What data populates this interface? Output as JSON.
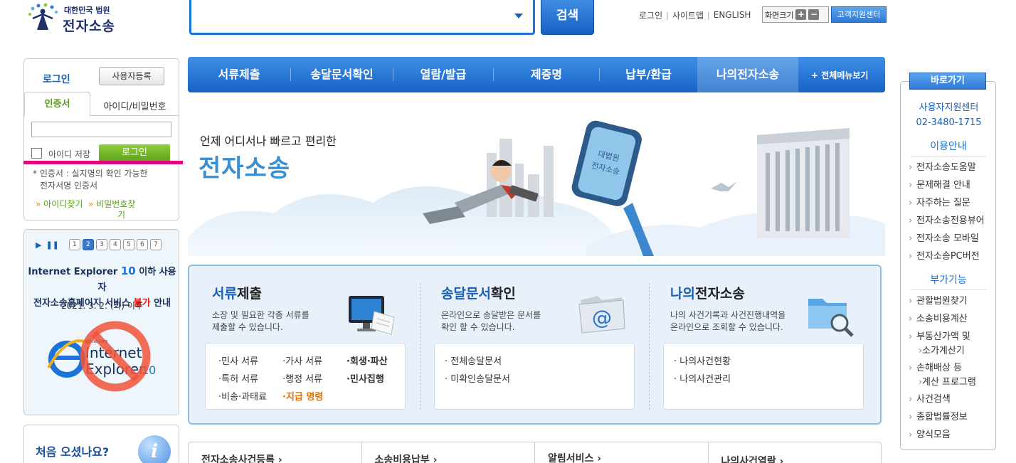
{
  "logo": {
    "small": "대한민국 법원",
    "big": "전자소송"
  },
  "search": {
    "value": "",
    "placeholder": "",
    "button_label": "검색"
  },
  "top_links": {
    "login": "로그인",
    "sitemap": "사이트맵",
    "english": "ENGLISH",
    "zoom_label": "화면크기",
    "zoom_in": "+",
    "zoom_out": "−",
    "support_label": "고객지원센터"
  },
  "login": {
    "title": "로그인",
    "register_label": "사용자등록",
    "tab_cert": "인증서",
    "tab_id": "아이디/비밀번호",
    "save_id_label": "아이디 저장",
    "login_button": "로그인",
    "note_line1": "* 인증서 : 실지명의 확인 가능한",
    "note_line2": "전자서명 인증서",
    "find_id": "아이디찾기",
    "find_pw_a": "비밀번호찾",
    "find_pw_b": "기"
  },
  "notice": {
    "play": "▶",
    "pause": "❚❚",
    "pages": [
      "1",
      "2",
      "3",
      "4",
      "5",
      "6",
      "7"
    ],
    "active_page": 2,
    "line1_a": "Internet Explorer ",
    "line1_b": "10",
    "line1_c": " 이하 사용자",
    "line2_a": "전자소송홈페이지 서비스 ",
    "line2_b": "불가",
    "line2_c": " 안내",
    "date": "2021. 3. 2. (화) 이후",
    "ie_windows": "Windows",
    "ie_internet": "Internet",
    "ie_explorer": "Explorer",
    "ie_version": "10"
  },
  "first_visit": {
    "text": "처음 오셨나요?",
    "icon_letter": "i"
  },
  "nav": {
    "items": [
      "서류제출",
      "송달문서확인",
      "열람/발급",
      "제증명",
      "납부/환급",
      "나의전자소송"
    ],
    "active_index": 5,
    "all_menu": "+ 전체메뉴보기"
  },
  "banner": {
    "sub": "언제 어디서나 빠르고 편리한",
    "title": "전자소송",
    "sign_text_1": "대법원",
    "sign_text_2": "전자소송"
  },
  "services": {
    "submit": {
      "title_a": "서류",
      "title_b": "제출",
      "desc1": "소장 및 필요한 각종 서류를",
      "desc2": "제출할 수 있습니다.",
      "links": [
        "·민사 서류",
        "·가사 서류",
        "·회생·파산",
        "·특허 서류",
        "·행정 서류",
        "·민사집행",
        "·비송·과태료",
        "·지급 명령"
      ]
    },
    "delivery": {
      "title_a": "송달문서",
      "title_b": "확인",
      "desc1": "온라인으로 송달받은 문서를",
      "desc2": "확인 할 수 있습니다.",
      "links": [
        "· 전체송달문서",
        "· 미확인송달문서"
      ]
    },
    "my": {
      "title_a": "나의",
      "title_b": "전자소송",
      "desc1": "나의 사건기록과 사건진행내역을",
      "desc2": "온라인으로 조회할 수 있습니다.",
      "links": [
        "· 나의사건현황",
        "· 나의사건관리"
      ]
    }
  },
  "bottom": [
    "전자소송사건등록 ›",
    "소송비용납부 ›",
    "알림서비스 ›",
    "나의사건열람 ›"
  ],
  "quick": {
    "title": "바로가기",
    "center_name": "사용자지원센터",
    "center_phone": "02-3480-1715",
    "usage_head": "이용안내",
    "usage_items": [
      "전자소송도움말",
      "문제해결 안내",
      "자주하는 질문",
      "전자소송전용뷰어",
      "전자소송 모바일",
      "전자소송PC버전"
    ],
    "extra_head": "부가기능",
    "extra_items": [
      "관할법원찾기",
      "소송비용계산",
      "부동산가액 및",
      "소가계산기",
      "손해배상 등",
      "계산 프로그램",
      "사건검색",
      "종합법률정보",
      "양식모음"
    ]
  }
}
